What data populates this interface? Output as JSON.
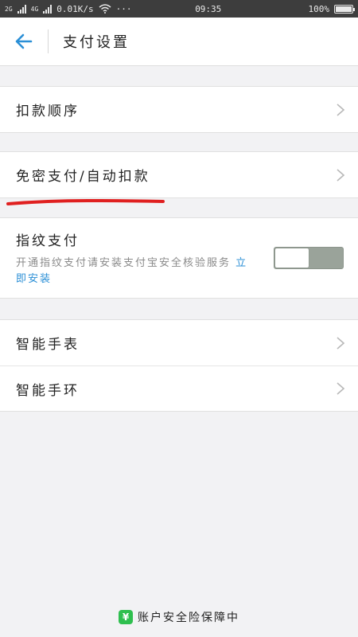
{
  "status_bar": {
    "network_left": "2G",
    "network_right": "4G",
    "speed": "0.01K/s",
    "more": "···",
    "time": "09:35",
    "battery_percent": "100%",
    "battery_level": 1.0
  },
  "header": {
    "back_icon": "arrow-left-icon",
    "title": "支付设置"
  },
  "groups": {
    "deduction_order": {
      "label": "扣款顺序"
    },
    "password_free": {
      "label": "免密支付/自动扣款"
    },
    "fingerprint": {
      "title": "指纹支付",
      "desc": "开通指纹支付请安装支付宝安全核验服务",
      "link": "立即安装",
      "toggle_on": false
    },
    "smart_watch": {
      "label": "智能手表"
    },
    "smart_band": {
      "label": "智能手环"
    }
  },
  "footer": {
    "badge": "¥",
    "text": "账户安全险保障中"
  },
  "colors": {
    "accent": "#2b8fd6",
    "annotation_red": "#e02020",
    "footer_green": "#2fbf4f"
  }
}
